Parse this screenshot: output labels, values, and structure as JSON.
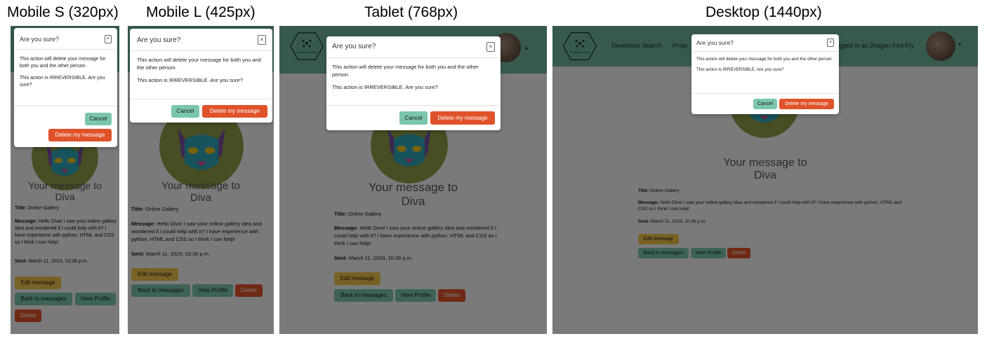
{
  "captions": {
    "mobile_s": "Mobile S (320px)",
    "mobile_l": "Mobile L (425px)",
    "tablet": "Tablet (768px)",
    "desktop": "Desktop (1440px)"
  },
  "colors": {
    "nav": "#6fb59a",
    "cancel": "#7ac6ad",
    "delete": "#e0532a",
    "edit": "#f1c24b"
  },
  "nav": {
    "logo_text": "Developer Connect",
    "link_1": "Developer Search",
    "link_2": "Proje",
    "logged_in": "gged in as Dragon-Fire-Fly"
  },
  "modal": {
    "title": "Are you sure?",
    "close": "×",
    "body_1": "This action will delete your message for both you and the other person.",
    "body_2": "This action is IRREVERSIBLE. Are you sure?",
    "cancel": "Cancel",
    "delete": "Delete my message"
  },
  "message": {
    "heading_1": "Your message to",
    "heading_2": "Diva",
    "title_label": "Title:",
    "title_value": " Online Gallery",
    "message_label": "Message:",
    "message_value": " Hello Diva! I saw your online gallery idea and wondered if I could help with it? I have experience with python, HTML and CSS so I think I can help!",
    "sent_label": "Sent:",
    "sent_value": " March 11, 2023, 10:36 p.m."
  },
  "buttons": {
    "edit": "Edit message",
    "back": "Back to messages",
    "profile": "View Profile",
    "delete": "Delete"
  }
}
